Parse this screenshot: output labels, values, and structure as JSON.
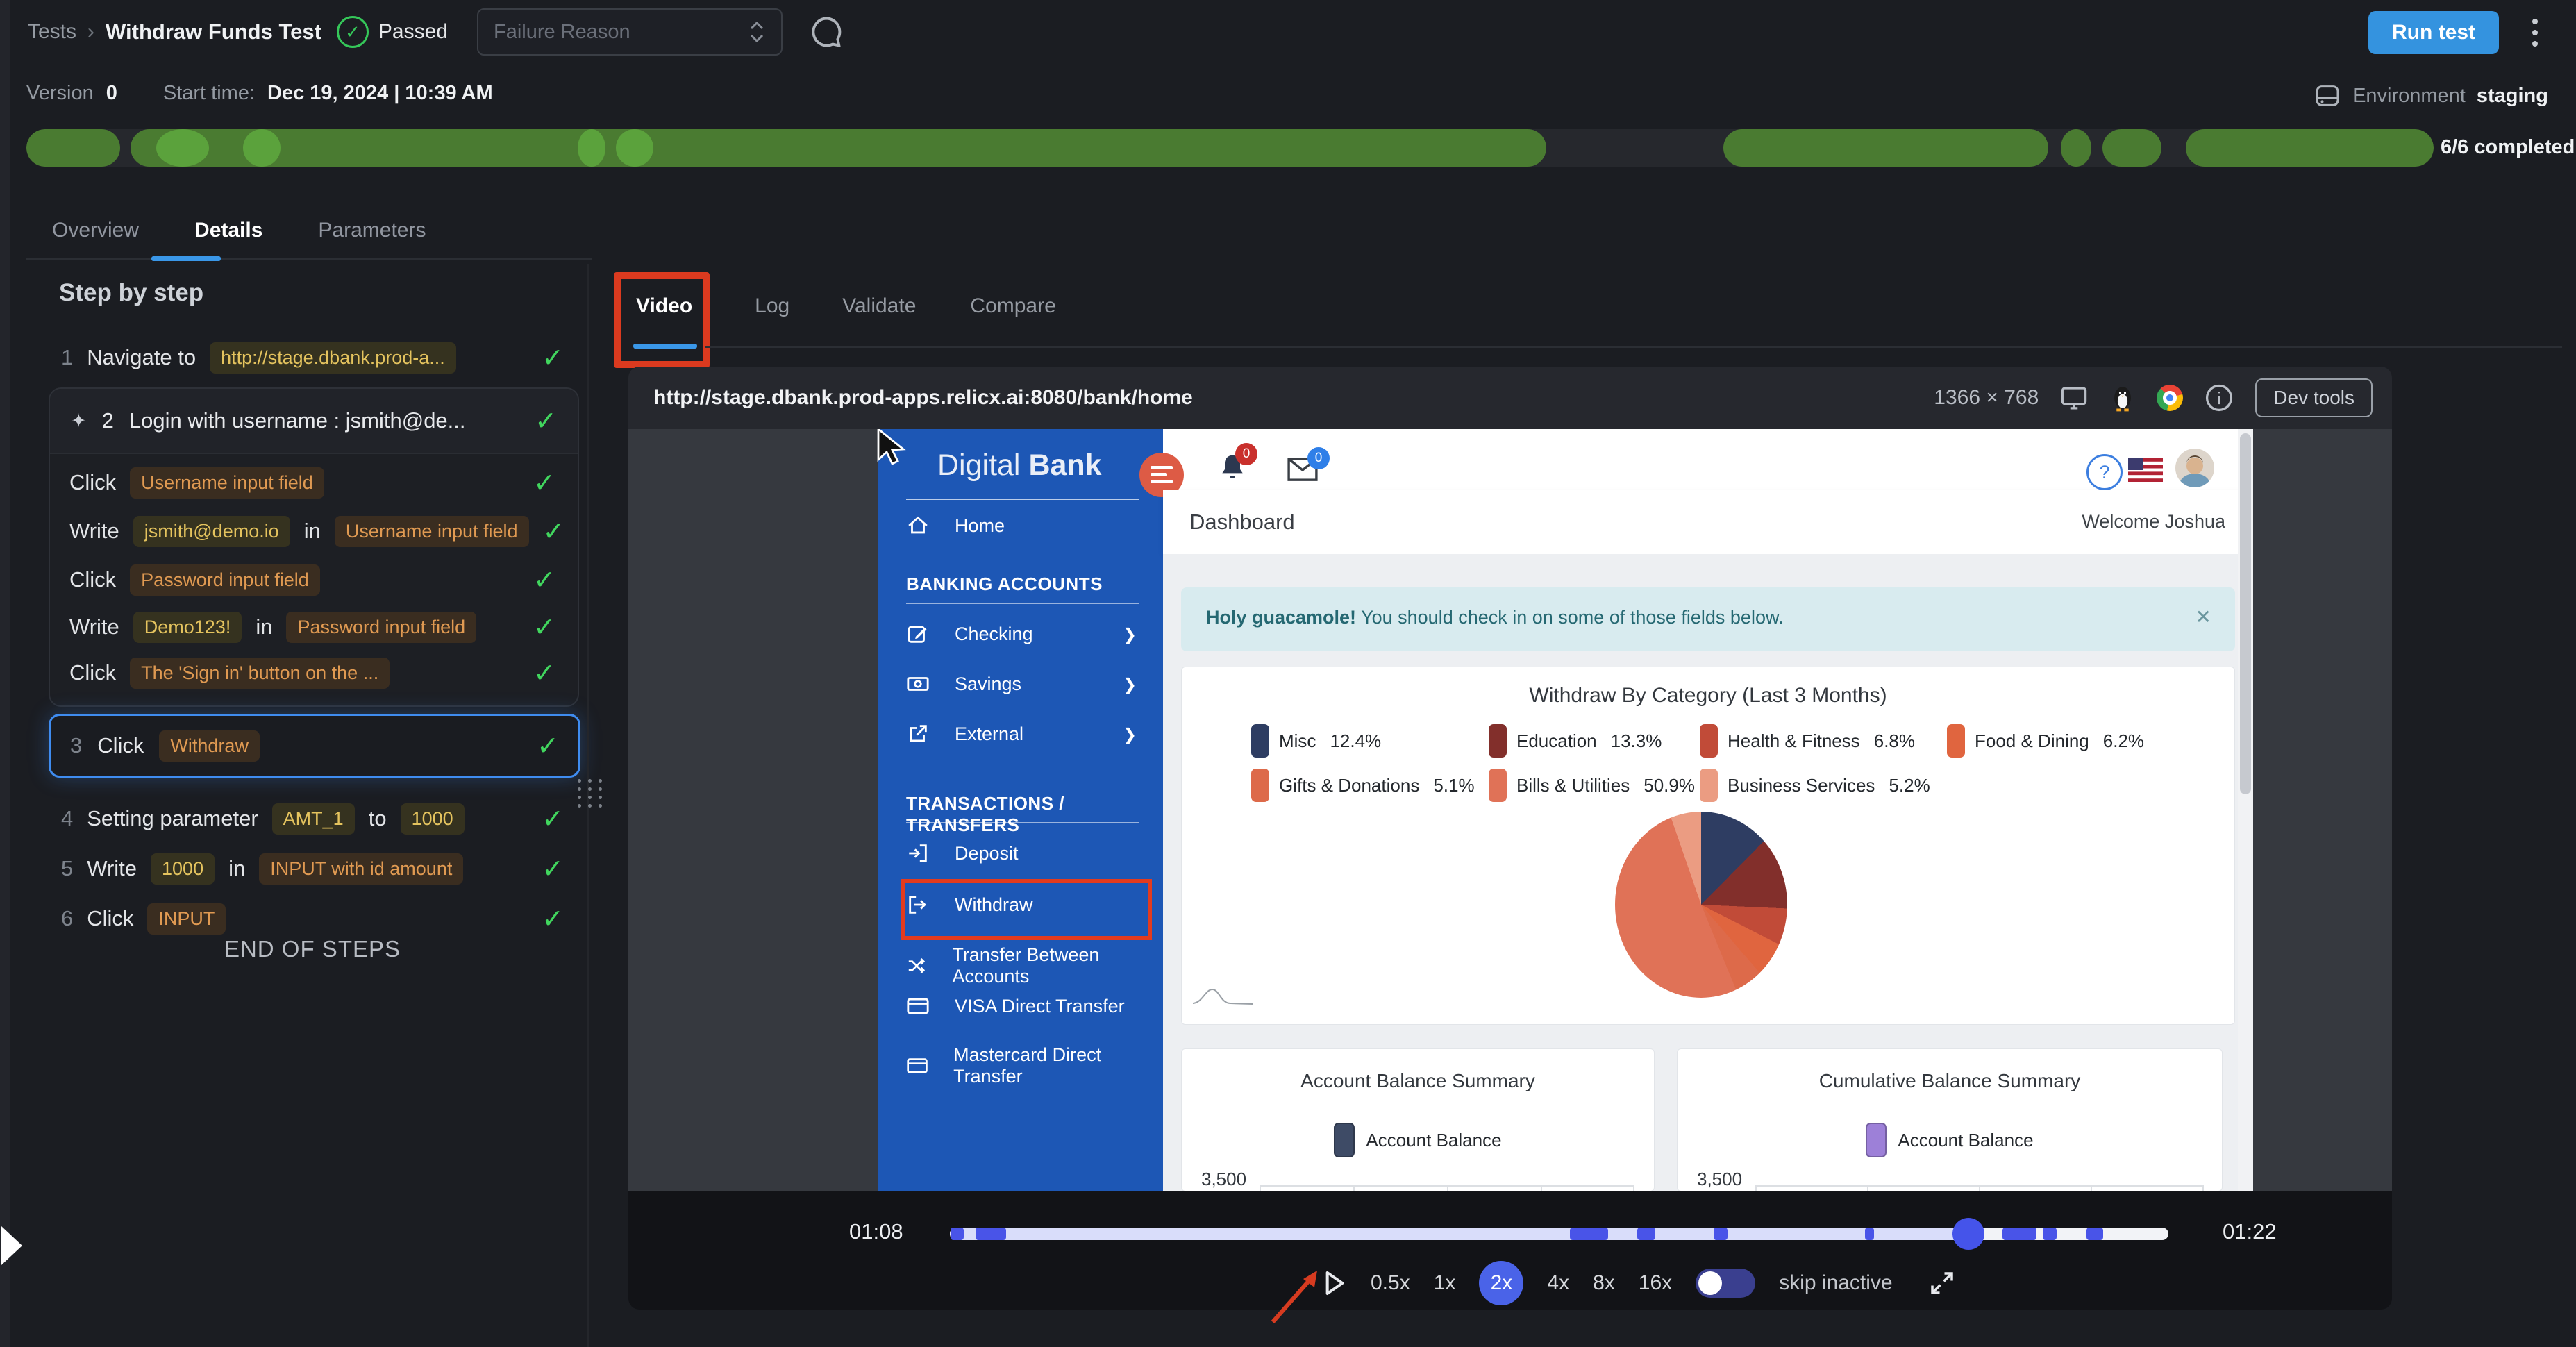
{
  "topbar": {
    "breadcrumb_root": "Tests",
    "breadcrumb_sep": "›",
    "title": "Withdraw Funds Test",
    "status_check": "✓",
    "status": "Passed",
    "failure_placeholder": "Failure Reason",
    "run_button": "Run test"
  },
  "meta": {
    "version_label": "Version",
    "version_value": "0",
    "start_label": "Start time:",
    "start_value": "Dec 19, 2024 | 10:39 AM",
    "env_label": "Environment",
    "env_value": "staging",
    "completed": "6/6 completed",
    "progress": {
      "bar_color": "#4a7b31",
      "light_color": "#5ba23c",
      "segments": [
        {
          "l": 0,
          "w": 3.9
        },
        {
          "l": 4.33,
          "w": 58.8
        },
        {
          "l": 70.5,
          "w": 13.5
        },
        {
          "l": 84.5,
          "w": 1.27,
          "dot": true
        },
        {
          "l": 86.25,
          "w": 2.45
        },
        {
          "l": 89.7,
          "w": 10.3
        }
      ],
      "lights": [
        {
          "l": 5.4,
          "w": 2.2
        },
        {
          "l": 9.0,
          "w": 1.55
        },
        {
          "l": 22.9,
          "w": 1.15
        },
        {
          "l": 24.5,
          "w": 1.55
        }
      ]
    }
  },
  "main_tabs": {
    "overview": "Overview",
    "details": "Details",
    "parameters": "Parameters",
    "active": "Details"
  },
  "steps": {
    "title": "Step by step",
    "end_label": "END OF STEPS",
    "s1": {
      "num": "1",
      "a": "Navigate to",
      "url": "http://stage.dbank.prod-a...",
      "check": "✓"
    },
    "s2": {
      "num": "2",
      "icon": "✦",
      "label": "Login with username : jsmith@de...",
      "check": "✓"
    },
    "s2c1": {
      "a": "Click",
      "b": "Username input field",
      "check": "✓"
    },
    "s2c2": {
      "a": "Write",
      "b": "jsmith@demo.io",
      "c": "in",
      "d": "Username input field",
      "check": "✓"
    },
    "s2c3": {
      "a": "Click",
      "b": "Password input field",
      "check": "✓"
    },
    "s2c4": {
      "a": "Write",
      "b": "Demo123!",
      "c": "in",
      "d": "Password input field",
      "check": "✓"
    },
    "s2c5": {
      "a": "Click",
      "b": "The 'Sign in' button on the ...",
      "check": "✓"
    },
    "s3": {
      "num": "3",
      "a": "Click",
      "b": "Withdraw",
      "check": "✓",
      "selected": true
    },
    "s4": {
      "num": "4",
      "a": "Setting parameter",
      "b": "AMT_1",
      "c": "to",
      "d": "1000",
      "check": "✓"
    },
    "s5": {
      "num": "5",
      "a": "Write",
      "b": "1000",
      "c": "in",
      "d": "INPUT with id amount",
      "check": "✓"
    },
    "s6": {
      "num": "6",
      "a": "Click",
      "b": "INPUT",
      "check": "✓"
    }
  },
  "video_panel": {
    "tabs": {
      "video": "Video",
      "log": "Log",
      "validate": "Validate",
      "compare": "Compare",
      "active": "Video"
    },
    "url": "http://stage.dbank.prod-apps.relicx.ai:8080/bank/home",
    "resolution": "1366 × 768",
    "devtools_button": "Dev tools",
    "time_current": "01:08",
    "time_total": "01:22",
    "speeds": [
      "0.5x",
      "1x",
      "2x",
      "4x",
      "8x",
      "16x"
    ],
    "active_speed": "2x",
    "skip_label": "skip inactive",
    "timeline": {
      "playhead_pct": 83.6,
      "marker_color": "#4954e8",
      "markers": [
        {
          "l": 0.06,
          "w": 1.1
        },
        {
          "l": 2.1,
          "w": 2.5
        },
        {
          "l": 50.9,
          "w": 3.1
        },
        {
          "l": 56.4,
          "w": 1.5
        },
        {
          "l": 62.7,
          "w": 1.1
        },
        {
          "l": 75.1,
          "w": 0.75
        },
        {
          "l": 86.4,
          "w": 2.75
        },
        {
          "l": 89.7,
          "w": 1.15
        },
        {
          "l": 93.3,
          "w": 1.35
        }
      ]
    }
  },
  "bank": {
    "brand_light": "Digital",
    "brand_bold": "Bank",
    "bell_badge": "0",
    "mail_badge": "0",
    "help_glyph": "?",
    "page_title": "Dashboard",
    "welcome": "Welcome Joshua",
    "alert_bold": "Holy guacamole!",
    "alert_text": "You should check in on some of those fields below.",
    "alert_close": "✕",
    "nav": {
      "home": "Home",
      "section1": "BANKING ACCOUNTS",
      "checking": "Checking",
      "savings": "Savings",
      "external": "External",
      "section2": "TRANSACTIONS / TRANSFERS",
      "deposit": "Deposit",
      "withdraw": "Withdraw",
      "transfer": "Transfer Between Accounts",
      "visa": "VISA Direct Transfer",
      "mastercard": "Mastercard Direct Transfer",
      "chevron": "❯"
    }
  },
  "chart_data": [
    {
      "type": "pie",
      "title": "Withdraw By Category (Last 3 Months)",
      "labels": [
        "Misc",
        "Education",
        "Health & Fitness",
        "Food & Dining",
        "Gifts & Donations",
        "Bills & Utilities",
        "Business Services"
      ],
      "values": [
        12.4,
        13.3,
        6.8,
        6.2,
        5.1,
        50.9,
        5.2
      ],
      "display_values": [
        "12.4%",
        "13.3%",
        "6.8%",
        "6.2%",
        "5.1%",
        "50.9%",
        "5.2%"
      ],
      "colors": [
        "#2e3d62",
        "#822f2b",
        "#c14b38",
        "#e0653f",
        "#dd6a4a",
        "#e07257",
        "#eb9c82"
      ],
      "legend_position": "top"
    },
    {
      "type": "bar",
      "title": "Account Balance Summary",
      "series": [
        {
          "name": "Account Balance"
        }
      ],
      "color": "#3e4b66",
      "y_ticks": [
        "3,500"
      ]
    },
    {
      "type": "bar",
      "title": "Cumulative Balance Summary",
      "series": [
        {
          "name": "Account Balance"
        }
      ],
      "color": "#9d80d8",
      "y_ticks": [
        "3,500"
      ]
    }
  ]
}
